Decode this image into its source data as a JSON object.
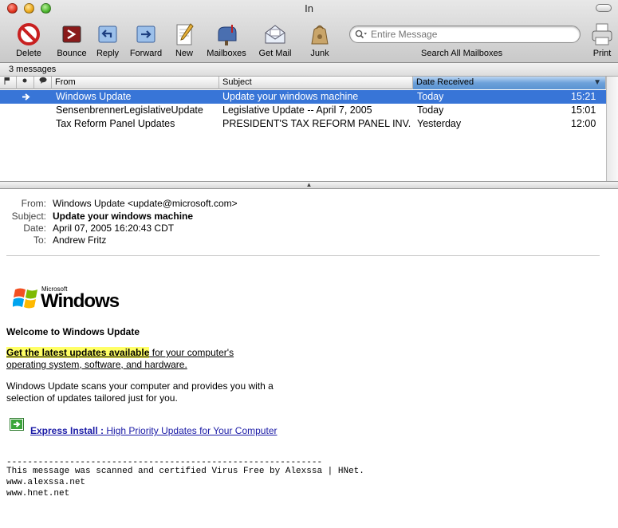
{
  "window": {
    "title": "In"
  },
  "toolbar": {
    "delete": "Delete",
    "bounce": "Bounce",
    "reply": "Reply",
    "forward": "Forward",
    "new": "New",
    "mailboxes": "Mailboxes",
    "get_mail": "Get Mail",
    "junk": "Junk",
    "search_placeholder": "Entire Message",
    "search_label": "Search All Mailboxes",
    "print": "Print"
  },
  "count": "3 messages",
  "columns": {
    "from": "From",
    "subject": "Subject",
    "date": "Date Received"
  },
  "messages": [
    {
      "from": "Windows Update",
      "subject": "Update your windows machine",
      "date": "Today",
      "time": "15:21"
    },
    {
      "from": "SensenbrennerLegislativeUpdate",
      "subject": "Legislative Update -- April 7, 2005",
      "date": "Today",
      "time": "15:01"
    },
    {
      "from": "Tax Reform Panel Updates",
      "subject": "PRESIDENT'S TAX REFORM PANEL INV...",
      "date": "Yesterday",
      "time": "12:00"
    }
  ],
  "message": {
    "from_label": "From:",
    "from": "Windows Update <update@microsoft.com>",
    "subject_label": "Subject:",
    "subject": "Update your windows machine",
    "date_label": "Date:",
    "date": "April 07, 2005 16:20:43 CDT",
    "to_label": "To:",
    "to": "Andrew Fritz",
    "logo_small": "Microsoft",
    "logo_big": "Windows",
    "welcome": "Welcome to Windows Update",
    "highlight": "Get the latest updates available",
    "line1_rest": " for your computer's",
    "line2": "operating system, software, and hardware.",
    "para1": "Windows Update scans your computer and provides you with a",
    "para2": "selection of updates tailored just for you.",
    "express_bold": "Express Install :",
    "express_rest": " High Priority Updates for Your Computer",
    "rule": "------------------------------------------------------------",
    "footer1": "This message was scanned and certified Virus Free by Alexssa | HNet.",
    "footer2": "www.alexssa.net",
    "footer3": "www.hnet.net"
  },
  "colors": {
    "selection": "#3875d7",
    "highlight": "#ffff66",
    "link": "#1a1aa6"
  }
}
